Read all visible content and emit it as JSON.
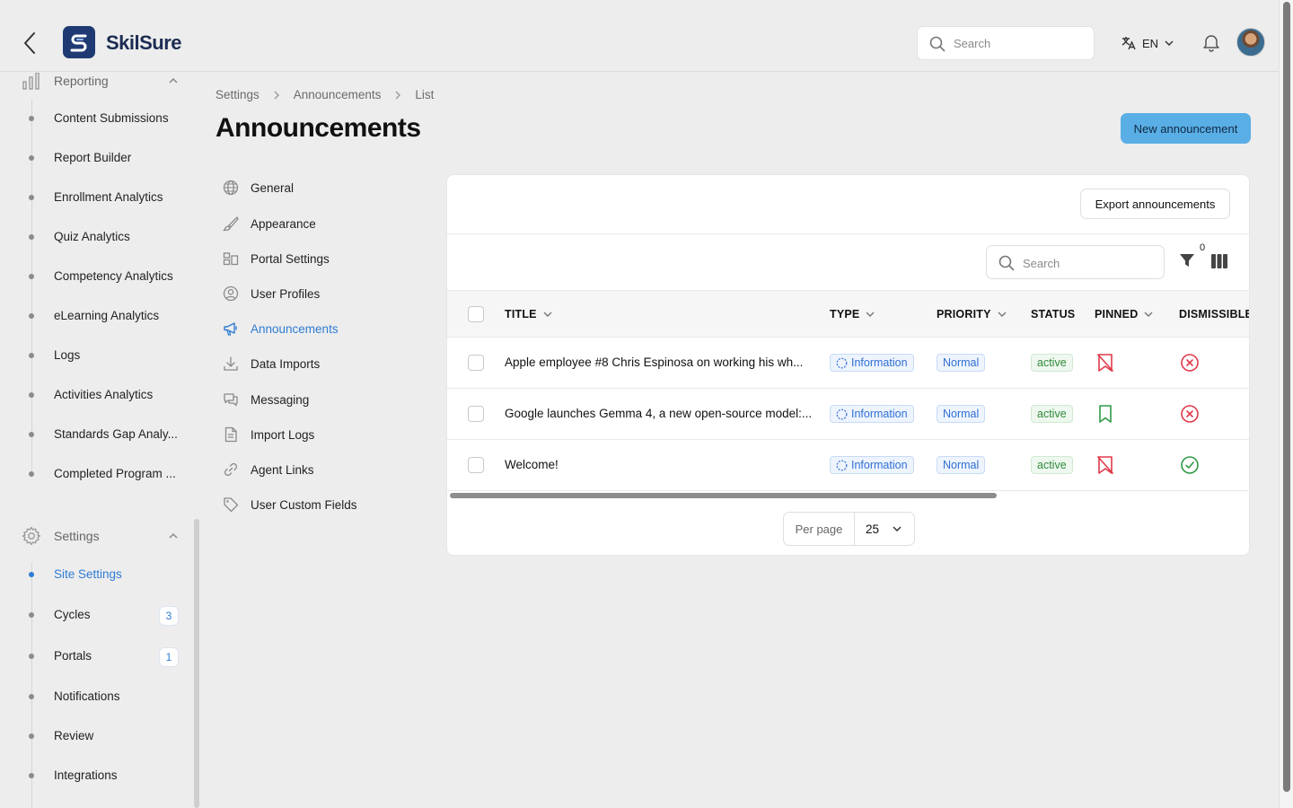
{
  "brand": {
    "name": "SkilSure"
  },
  "header": {
    "search_placeholder": "Search",
    "language": "EN",
    "icons": [
      "back-icon",
      "search-icon",
      "translate-icon",
      "chevron-down-icon",
      "bell-icon"
    ]
  },
  "sidebar": {
    "reporting": {
      "label": "Reporting",
      "items": [
        {
          "label": "Content Submissions"
        },
        {
          "label": "Report Builder"
        },
        {
          "label": "Enrollment Analytics"
        },
        {
          "label": "Quiz Analytics"
        },
        {
          "label": "Competency Analytics"
        },
        {
          "label": "eLearning Analytics"
        },
        {
          "label": "Logs"
        },
        {
          "label": "Activities Analytics"
        },
        {
          "label": "Standards Gap Analy..."
        },
        {
          "label": "Completed Program ..."
        }
      ]
    },
    "settings": {
      "label": "Settings",
      "items": [
        {
          "label": "Site Settings",
          "active": true
        },
        {
          "label": "Cycles",
          "badge": "3"
        },
        {
          "label": "Portals",
          "badge": "1"
        },
        {
          "label": "Notifications"
        },
        {
          "label": "Review"
        },
        {
          "label": "Integrations"
        }
      ]
    }
  },
  "breadcrumb": [
    "Settings",
    "Announcements",
    "List"
  ],
  "page": {
    "title": "Announcements",
    "new_button": "New announcement"
  },
  "subnav": [
    {
      "label": "General",
      "icon": "globe-icon"
    },
    {
      "label": "Appearance",
      "icon": "brush-icon"
    },
    {
      "label": "Portal Settings",
      "icon": "portal-icon"
    },
    {
      "label": "User Profiles",
      "icon": "user-circle-icon"
    },
    {
      "label": "Announcements",
      "icon": "megaphone-icon",
      "active": true
    },
    {
      "label": "Data Imports",
      "icon": "download-icon"
    },
    {
      "label": "Messaging",
      "icon": "chat-icon"
    },
    {
      "label": "Import Logs",
      "icon": "document-icon"
    },
    {
      "label": "Agent Links",
      "icon": "link-icon"
    },
    {
      "label": "User Custom Fields",
      "icon": "tag-icon"
    }
  ],
  "table": {
    "export_button": "Export announcements",
    "search_placeholder": "Search",
    "filter_count": "0",
    "columns": [
      "TITLE",
      "TYPE",
      "PRIORITY",
      "STATUS",
      "PINNED",
      "DISMISSIBLE"
    ],
    "rows": [
      {
        "title": "Apple employee #8 Chris Espinosa on working his wh...",
        "type": "Information",
        "priority": "Normal",
        "status": "active",
        "pinned": false,
        "dismissible": false
      },
      {
        "title": "Google launches Gemma 4, a new open-source model:...",
        "type": "Information",
        "priority": "Normal",
        "status": "active",
        "pinned": true,
        "dismissible": false
      },
      {
        "title": "Welcome!",
        "type": "Information",
        "priority": "Normal",
        "status": "active",
        "pinned": false,
        "dismissible": true
      }
    ],
    "pagination": {
      "per_page_label": "Per page",
      "per_page_value": "25"
    }
  },
  "colors": {
    "accent": "#2f7cd3",
    "primary_button": "#5aaee6",
    "danger": "#e03a4a",
    "success": "#2f9a45"
  }
}
